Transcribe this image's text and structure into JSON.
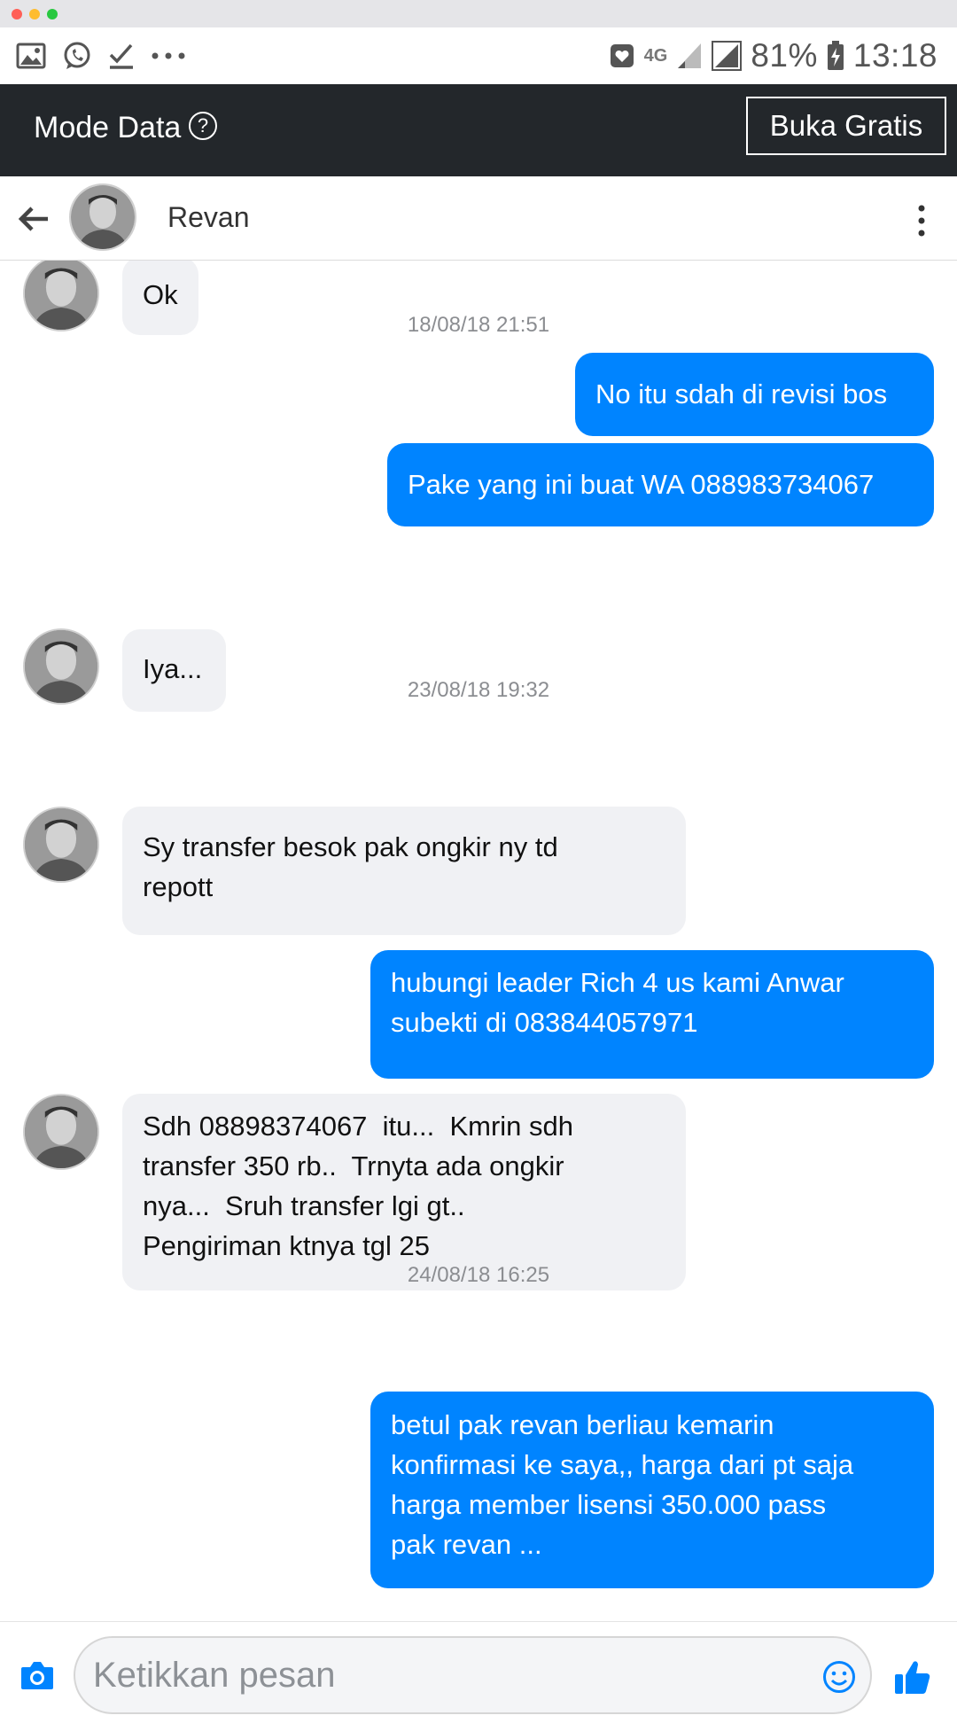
{
  "statusbar": {
    "network": "4G",
    "battery": "81%",
    "time": "13:18",
    "icons": [
      "image-icon",
      "whatsapp-icon",
      "check-icon",
      "more-dots-icon",
      "notification-icon",
      "signal-icon",
      "signal-icon",
      "battery-charging-icon"
    ]
  },
  "banner": {
    "title": "Mode Data",
    "help": "?",
    "button": "Buka Gratis"
  },
  "header": {
    "name": "Revan",
    "icons": [
      "back-arrow-icon",
      "avatar",
      "more-vert-icon"
    ]
  },
  "messages": [
    {
      "type": "in",
      "text": "Ok"
    },
    {
      "type": "stamp",
      "text": "18/08/18 21:51"
    },
    {
      "type": "out",
      "text": "No itu sdah di revisi bos"
    },
    {
      "type": "out",
      "text": "Pake yang ini buat WA 088983734067"
    },
    {
      "type": "in",
      "text": "Iya..."
    },
    {
      "type": "stamp",
      "text": "23/08/18 19:32"
    },
    {
      "type": "in",
      "lines": [
        "Sy transfer besok pak ongkir ny td",
        "repott"
      ]
    },
    {
      "type": "out",
      "lines": [
        "hubungi leader Rich 4 us kami Anwar",
        "subekti di 083844057971"
      ]
    },
    {
      "type": "in",
      "lines": [
        "Sdh 08898374067  itu...  Kmrin sdh",
        "transfer 350 rb..  Trnyta ada ongkir",
        "nya...  Sruh transfer lgi gt..",
        "Pengiriman ktnya tgl 25"
      ]
    },
    {
      "type": "stamp",
      "text": "24/08/18 16:25"
    },
    {
      "type": "out",
      "lines": [
        "betul pak revan berliau kemarin",
        "konfirmasi ke saya,, harga dari pt saja",
        "harga member lisensi 350.000 pass",
        "pak revan ..."
      ]
    }
  ],
  "composer": {
    "placeholder": "Ketikkan pesan",
    "icons": [
      "camera-icon",
      "emoji-icon",
      "thumbs-up-icon"
    ]
  },
  "colors": {
    "outgoing_bubble": "#0084ff",
    "incoming_bubble": "#f0f1f4",
    "banner": "#23272b"
  }
}
